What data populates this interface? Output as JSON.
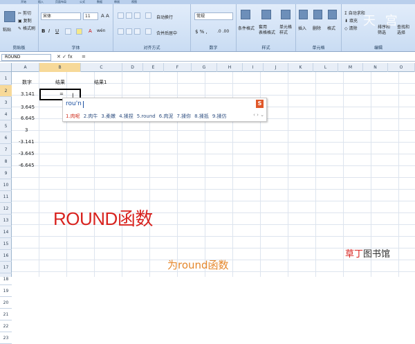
{
  "ribbon": {
    "tabs": [
      "开始",
      "插入",
      "页面布局",
      "公式",
      "数据",
      "审阅",
      "视图"
    ],
    "clipboard": {
      "paste": "粘贴",
      "cut": "剪切",
      "copy": "复制",
      "format_painter": "格式刷",
      "group": "剪贴板"
    },
    "font": {
      "name": "宋体",
      "size": "11",
      "group": "字体"
    },
    "alignment": {
      "wrap": "自动换行",
      "merge": "合并后居中",
      "group": "对齐方式"
    },
    "number": {
      "format": "常规",
      "group": "数字"
    },
    "styles": {
      "conditional": "条件格式",
      "table": "套用\n表格格式",
      "cell": "单元格\n样式",
      "group": "样式"
    },
    "cells": {
      "insert": "插入",
      "delete": "删除",
      "format": "格式",
      "group": "单元格"
    },
    "editing": {
      "autosum": "自动求和",
      "fill": "填充",
      "clear": "清除",
      "sort": "排序和\n筛选",
      "find": "查找和\n选择",
      "group": "编辑"
    }
  },
  "formula_bar": {
    "name_box": "ROUND",
    "icons": "✕ ✓ fx",
    "content": "="
  },
  "columns": [
    "A",
    "B",
    "C",
    "D",
    "E",
    "F",
    "G",
    "H",
    "I",
    "J",
    "K",
    "L",
    "M",
    "N",
    "O"
  ],
  "rows": [
    "1",
    "2",
    "3",
    "4",
    "5",
    "6",
    "7",
    "8",
    "9",
    "10",
    "11",
    "12",
    "13",
    "14",
    "15",
    "16",
    "17",
    "18",
    "19",
    "20",
    "21",
    "22",
    "23"
  ],
  "cells": {
    "a1": "数字",
    "b1": "结果",
    "c1": "结果1",
    "a2": "3.141",
    "b2": "=",
    "a3": "3.645",
    "a4": "6.645",
    "a5": "3",
    "a6": "-3.141",
    "a7": "-3.645",
    "a8": "-6.645"
  },
  "ime": {
    "input": "rou'n",
    "logo": "S",
    "candidates": [
      "1.肉呢",
      "2.肉牛",
      "3.柔嫩",
      "4.揉捏",
      "5.round",
      "6.肉泥",
      "7.揉你",
      "8.揉抵",
      "9.揉仿"
    ],
    "nav": "‹ › ⌄"
  },
  "overlay": {
    "title": "ROUND函数",
    "subtitle": "为round函数",
    "watermark_bottom_a": "草丁",
    "watermark_bottom_b": "图书馆",
    "watermark_top": "天 宫"
  }
}
